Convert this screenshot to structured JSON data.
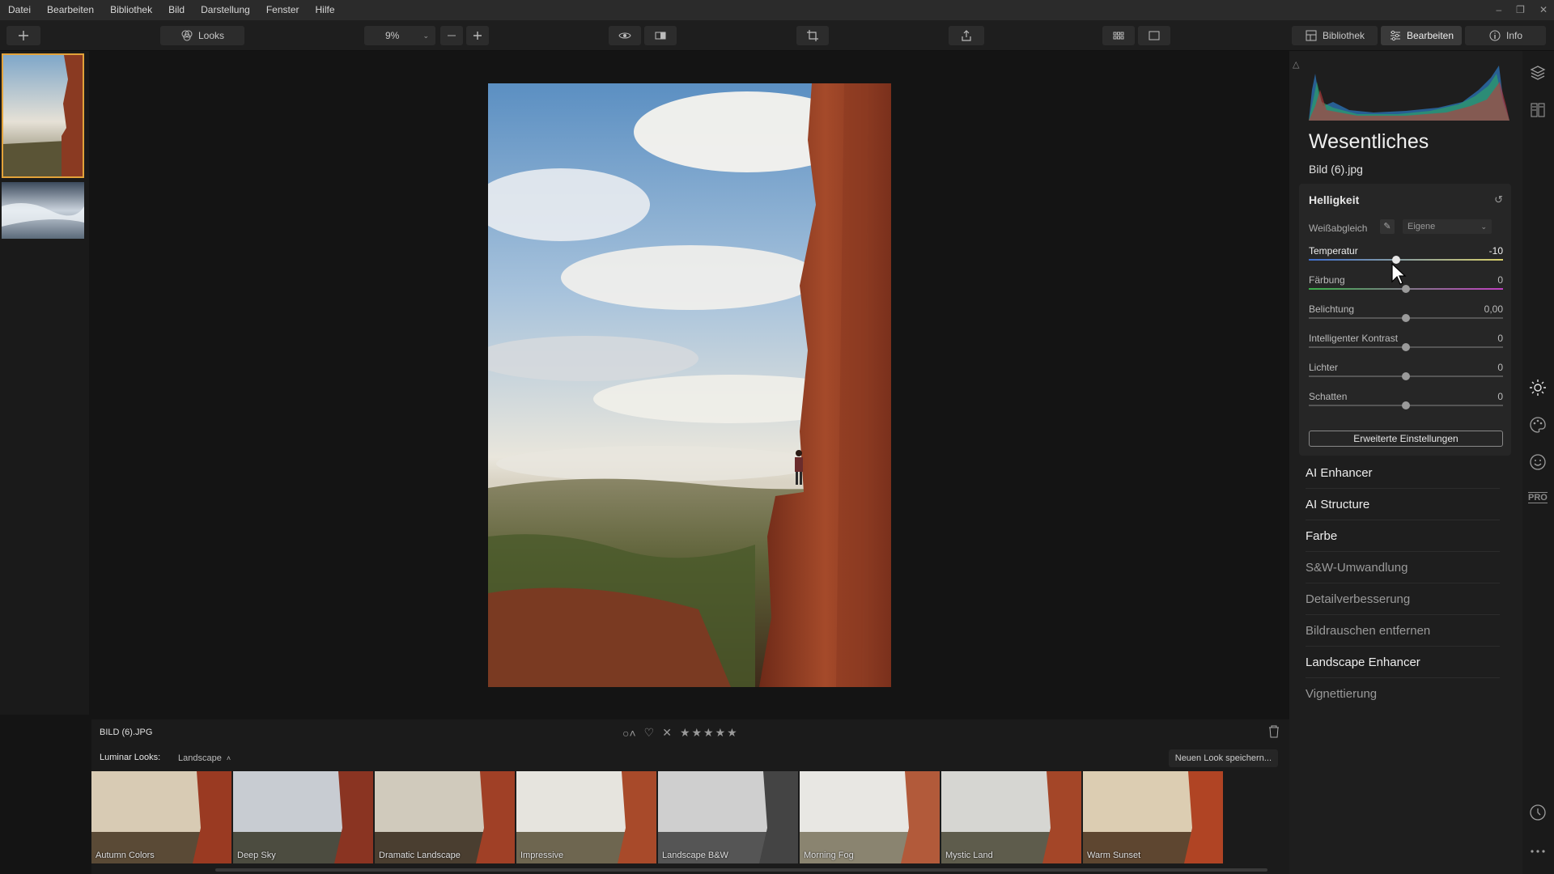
{
  "menu": {
    "items": [
      "Datei",
      "Bearbeiten",
      "Bibliothek",
      "Bild",
      "Darstellung",
      "Fenster",
      "Hilfe"
    ]
  },
  "toolbar": {
    "looks_label": "Looks",
    "zoom_value": "9%",
    "tabs": {
      "bibliothek": "Bibliothek",
      "bearbeiten": "Bearbeiten",
      "info": "Info"
    }
  },
  "panel": {
    "title": "Wesentliches",
    "filename": "Bild (6).jpg",
    "helligkeit": {
      "title": "Helligkeit",
      "wb_label": "Weißabgleich",
      "wb_value": "Eigene",
      "sliders": [
        {
          "label": "Temperatur",
          "value": "-10",
          "pos": 0.45
        },
        {
          "label": "Färbung",
          "value": "0",
          "pos": 0.5
        },
        {
          "label": "Belichtung",
          "value": "0,00",
          "pos": 0.5
        },
        {
          "label": "Intelligenter Kontrast",
          "value": "0",
          "pos": 0.5
        },
        {
          "label": "Lichter",
          "value": "0",
          "pos": 0.5
        },
        {
          "label": "Schatten",
          "value": "0",
          "pos": 0.5
        }
      ],
      "advanced_button": "Erweiterte Einstellungen"
    },
    "tools": [
      {
        "label": "AI Enhancer",
        "active": true
      },
      {
        "label": "AI Structure",
        "active": true
      },
      {
        "label": "Farbe",
        "active": true
      },
      {
        "label": "S&W-Umwandlung",
        "active": false
      },
      {
        "label": "Detailverbesserung",
        "active": false
      },
      {
        "label": "Bildrauschen entfernen",
        "active": false
      },
      {
        "label": "Landscape Enhancer",
        "active": true
      },
      {
        "label": "Vignettierung",
        "active": false
      }
    ],
    "pro_badge": "PRO"
  },
  "bottom": {
    "filename": "BILD (6).JPG",
    "looks_label": "Luminar Looks:",
    "looks_category": "Landscape",
    "save_look_button": "Neuen Look speichern...",
    "looks": [
      "Autumn Colors",
      "Deep Sky",
      "Dramatic Landscape",
      "Impressive",
      "Landscape B&W",
      "Morning Fog",
      "Mystic Land",
      "Warm Sunset"
    ]
  },
  "colors": {
    "accent_selected": "#e2a23a",
    "panel_bg": "#1e1e1e"
  }
}
